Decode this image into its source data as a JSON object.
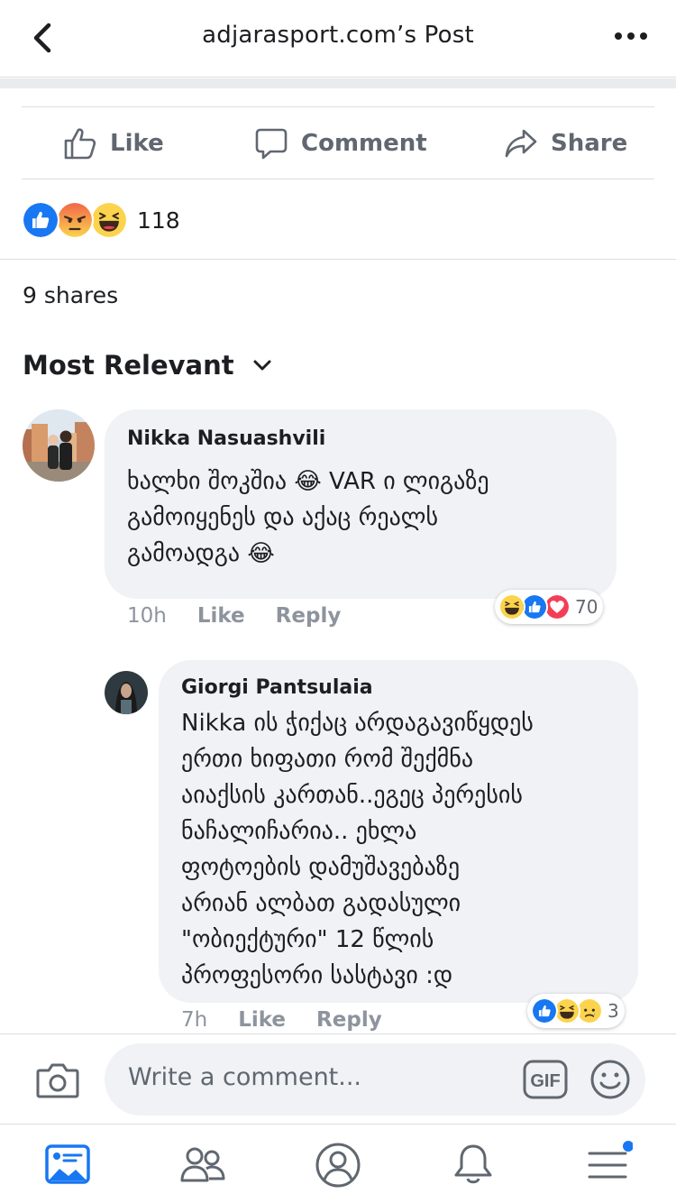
{
  "header": {
    "title": "adjarasport.com’s Post"
  },
  "actions": {
    "like": "Like",
    "comment": "Comment",
    "share": "Share"
  },
  "reactions": {
    "count": "118"
  },
  "shares": "9 shares",
  "sort": {
    "label": "Most Relevant"
  },
  "comments": [
    {
      "author": "Nikka Nasuashvili",
      "lines": [
        "ხალხი შოკშია 😂 VAR  ი ლიგაზე",
        "გამოიყენეს და აქაც რეალს",
        "გამოადგა 😂"
      ],
      "time": "10h",
      "like": "Like",
      "reply": "Reply",
      "reaction_count": "70"
    },
    {
      "author": "Giorgi Pantsulaia",
      "lines": [
        "Nikka ის ჭიქაც არდაგავიწყდეს",
        "ერთი ხიფათი რომ შექმნა",
        "აიაქსის კართან..ეგეც პერესის",
        "ნაჩალიჩარია.. ეხლა",
        "ფოტოების დამუშავებაზე",
        "არიან ალბათ გადასული",
        "\"ობიექტური\"  12 წლის",
        "პროფესორი სასტავი :დ"
      ],
      "time": "7h",
      "like": "Like",
      "reply": "Reply",
      "reaction_count": "3"
    }
  ],
  "composer": {
    "placeholder": "Write a comment...",
    "gif": "GIF"
  },
  "colors": {
    "accent": "#1877f2",
    "angry": "#f0874a",
    "love": "#f33e58",
    "haha": "#fcd34d"
  }
}
